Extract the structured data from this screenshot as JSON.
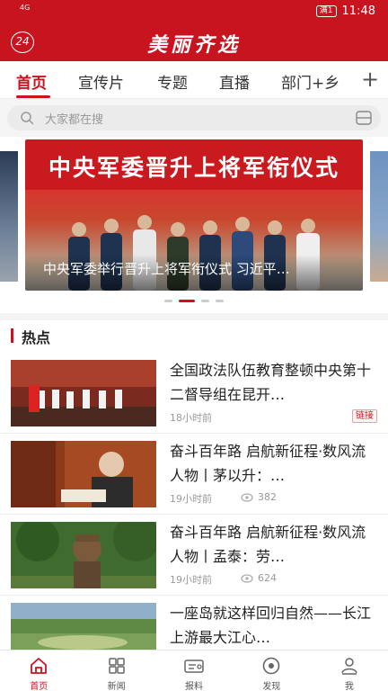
{
  "status_bar": {
    "signal": "4G",
    "battery": "满1",
    "time": "11:48"
  },
  "app_bar": {
    "badge": "24",
    "title": "美丽齐选"
  },
  "tabs": [
    {
      "label": "首页",
      "active": true
    },
    {
      "label": "宣传片",
      "active": false
    },
    {
      "label": "专题",
      "active": false
    },
    {
      "label": "直播",
      "active": false
    },
    {
      "label": "部门+乡",
      "active": false
    }
  ],
  "tab_add_icon": "plus-icon",
  "search": {
    "placeholder": "大家都在搜"
  },
  "banner": {
    "headline": "中央军委晋升上将军衔仪式",
    "caption": "中央军委举行晋升上将军衔仪式 习近平…",
    "dots": 4,
    "active_dot": 1
  },
  "section": {
    "title": "热点"
  },
  "news": [
    {
      "title": "全国政法队伍教育整顿中央第十二督导组在昆开…",
      "time": "18小时前",
      "views": "",
      "tag": "链接"
    },
    {
      "title": "奋斗百年路 启航新征程·数风流人物丨茅以升：…",
      "time": "19小时前",
      "views": "382",
      "tag": ""
    },
    {
      "title": "奋斗百年路 启航新征程·数风流人物丨孟泰：劳…",
      "time": "19小时前",
      "views": "624",
      "tag": ""
    },
    {
      "title": "一座岛就这样回归自然——长江上游最大江心…",
      "time": "",
      "views": "",
      "tag": ""
    }
  ],
  "bottom_nav": [
    {
      "label": "首页",
      "icon": "home-icon",
      "active": true
    },
    {
      "label": "新闻",
      "icon": "grid-icon",
      "active": false
    },
    {
      "label": "报料",
      "icon": "report-card-icon",
      "active": false
    },
    {
      "label": "发现",
      "icon": "discover-icon",
      "active": false
    },
    {
      "label": "我",
      "icon": "user-icon",
      "active": false
    }
  ],
  "colors": {
    "brand_red": "#c8141f",
    "text": "#222222",
    "muted": "#999999"
  }
}
